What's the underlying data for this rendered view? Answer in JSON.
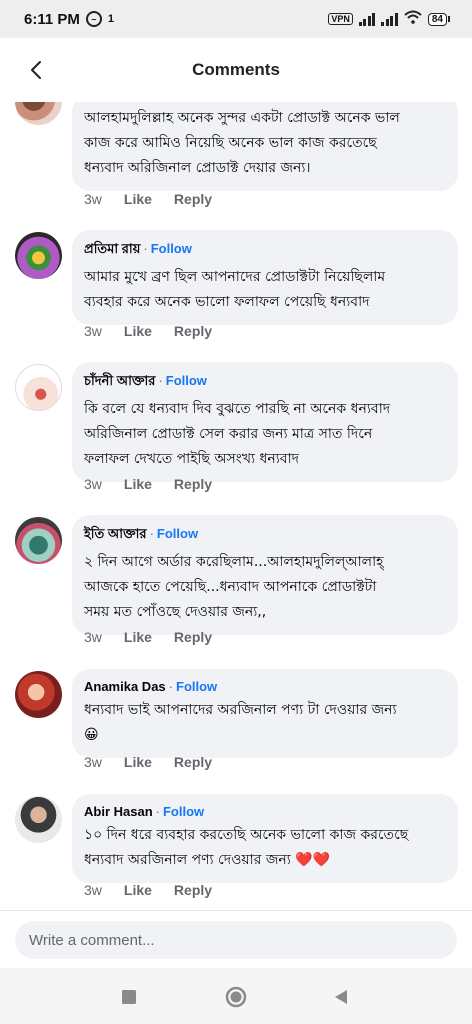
{
  "status_bar": {
    "time": "6:11 PM",
    "extra": "1",
    "vpn": "VPN",
    "battery": "84"
  },
  "header": {
    "title": "Comments"
  },
  "comments": [
    {
      "name": "",
      "follow": "",
      "text": "আলহামদুলিল্লাহ অনেক সুন্দর একটা প্রোডাক্ট অনেক ভাল\nকাজ করে আমিও নিয়েছি অনেক ভাল কাজ করতেছে\nধন্যবাদ অরিজিনাল প্রোডাক্ট দেয়ার জন্য।",
      "ago": "3w",
      "like": "Like",
      "reply": "Reply"
    },
    {
      "name": "প্রতিমা রায়",
      "follow": "Follow",
      "text": "আমার মুখে ব্রণ ছিল আপনাদের প্রোডাক্টটা নিয়েছিলাম\nব্যবহার করে অনেক ভালো ফলাফল পেয়েছি ধন্যবাদ",
      "ago": "3w",
      "like": "Like",
      "reply": "Reply"
    },
    {
      "name": "চাঁদনী আক্তার",
      "follow": "Follow",
      "text": "কি বলে যে ধন্যবাদ দিব বুঝতে পারছি না অনেক ধন্যবাদ\nঅরিজিনাল প্রোডাক্ট সেল করার জন্য মাত্র সাত দিনে\nফলাফল দেখতে পাইছি অসংখ্য ধন্যবাদ",
      "ago": "3w",
      "like": "Like",
      "reply": "Reply"
    },
    {
      "name": "ইতি আক্তার",
      "follow": "Follow",
      "text": "২ দিন আগে অর্ডার করেছিলাম...আলহামদুলিল্আলাহ্\nআজকে হাতে পেয়েছি...ধন্যবাদ আপনাকে প্রোডাক্টটা\nসময় মত পোঁওছে দেওয়ার জন্য,,",
      "ago": "3w",
      "like": "Like",
      "reply": "Reply"
    },
    {
      "name": "Anamika Das",
      "follow": "Follow",
      "text": "ধন্যবাদ ভাই আপনাদের অরজিনাল পণ্য টা দেওয়ার জন্য\n😀",
      "ago": "3w",
      "like": "Like",
      "reply": "Reply"
    },
    {
      "name": "Abir Hasan",
      "follow": "Follow",
      "text": "১০ দিন ধরে ব্যবহার করতেছি অনেক ভালো কাজ করতেছে\nধন্যবাদ অরজিনাল পণ্য দেওয়ার জন্য ❤️❤️",
      "ago": "3w",
      "like": "Like",
      "reply": "Reply"
    }
  ],
  "composer": {
    "placeholder": "Write a comment..."
  },
  "colors": {
    "follow": "#1877f2",
    "bubble": "#f0f2f5",
    "meta": "#65676b"
  }
}
